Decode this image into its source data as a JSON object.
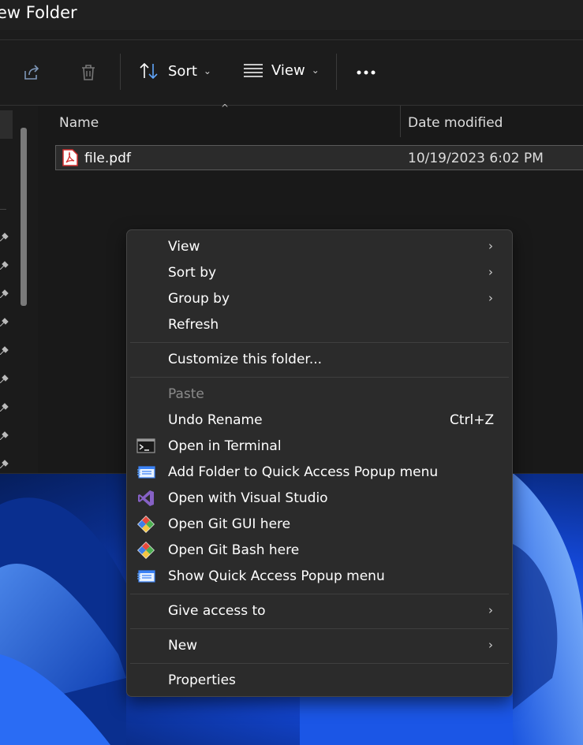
{
  "window": {
    "title": "ew Folder"
  },
  "toolbar": {
    "share_icon": "share-icon",
    "delete_icon": "trash-icon",
    "sort_label": "Sort",
    "view_label": "View",
    "more_icon": "more-icon"
  },
  "file_list": {
    "columns": [
      "Name",
      "Date modified"
    ],
    "rows": [
      {
        "name": "file.pdf",
        "date_modified": "10/19/2023 6:02 PM",
        "icon": "pdf-icon"
      }
    ]
  },
  "context_menu": {
    "items": [
      {
        "label": "View",
        "submenu": true
      },
      {
        "label": "Sort by",
        "submenu": true
      },
      {
        "label": "Group by",
        "submenu": true
      },
      {
        "label": "Refresh"
      },
      {
        "label": "Customize this folder..."
      },
      {
        "label": "Paste",
        "disabled": true
      },
      {
        "label": "Undo Rename",
        "shortcut": "Ctrl+Z"
      },
      {
        "label": "Open in Terminal",
        "icon": "terminal-icon"
      },
      {
        "label": "Add Folder to Quick Access Popup menu",
        "icon": "quick-access-popup-icon"
      },
      {
        "label": "Open with Visual Studio",
        "icon": "visual-studio-icon"
      },
      {
        "label": "Open Git GUI here",
        "icon": "git-icon"
      },
      {
        "label": "Open Git Bash here",
        "icon": "git-icon"
      },
      {
        "label": "Show Quick Access Popup menu",
        "icon": "quick-access-popup-icon"
      },
      {
        "label": "Give access to",
        "submenu": true
      },
      {
        "label": "New",
        "submenu": true
      },
      {
        "label": "Properties"
      }
    ],
    "submenu_glyph": "›"
  },
  "colors": {
    "menu_bg": "#2b2b2b",
    "window_bg": "#191919",
    "accent_blue": "#60a5fa",
    "pdf_red": "#d32f2f",
    "visual_studio_purple": "#8661c5"
  }
}
